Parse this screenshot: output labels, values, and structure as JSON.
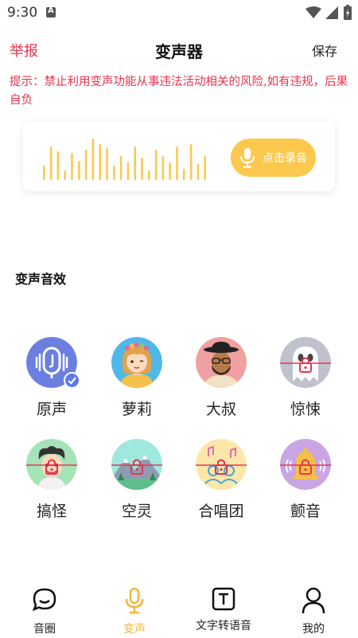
{
  "status_bar": {
    "time": "9:30"
  },
  "header": {
    "report_label": "举报",
    "title": "变声器",
    "save_label": "保存"
  },
  "warning_text": "提示：禁止利用变声功能从事违法活动相关的风险,如有违规，后果自负",
  "record": {
    "button_label": "点击录音",
    "accent_color": "#fcc94e"
  },
  "section_title": "变声音效",
  "effects": [
    {
      "label": "原声",
      "icon": "mic-icon",
      "selected": true,
      "locked": false
    },
    {
      "label": "萝莉",
      "icon": "girl-avatar",
      "selected": false,
      "locked": false
    },
    {
      "label": "大叔",
      "icon": "uncle-avatar",
      "selected": false,
      "locked": false
    },
    {
      "label": "惊悚",
      "icon": "ghost-avatar",
      "selected": false,
      "locked": true
    },
    {
      "label": "搞怪",
      "icon": "funny-avatar",
      "selected": false,
      "locked": true
    },
    {
      "label": "空灵",
      "icon": "mountain-avatar",
      "selected": false,
      "locked": true
    },
    {
      "label": "合唱团",
      "icon": "choir-avatar",
      "selected": false,
      "locked": true
    },
    {
      "label": "颤音",
      "icon": "bell-avatar",
      "selected": false,
      "locked": true
    }
  ],
  "bottom_nav": [
    {
      "label": "音圈",
      "icon": "chat-bubble-icon",
      "active": false
    },
    {
      "label": "变声",
      "icon": "mic-icon",
      "active": true
    },
    {
      "label": "文字转语音",
      "icon": "text-t-icon",
      "active": false
    },
    {
      "label": "我的",
      "icon": "user-icon",
      "active": false
    }
  ],
  "colors": {
    "accent_red": "#e8334e",
    "accent_yellow": "#fcc94e",
    "selected_blue": "#5b7be8",
    "lock_red": "#e8334e"
  }
}
